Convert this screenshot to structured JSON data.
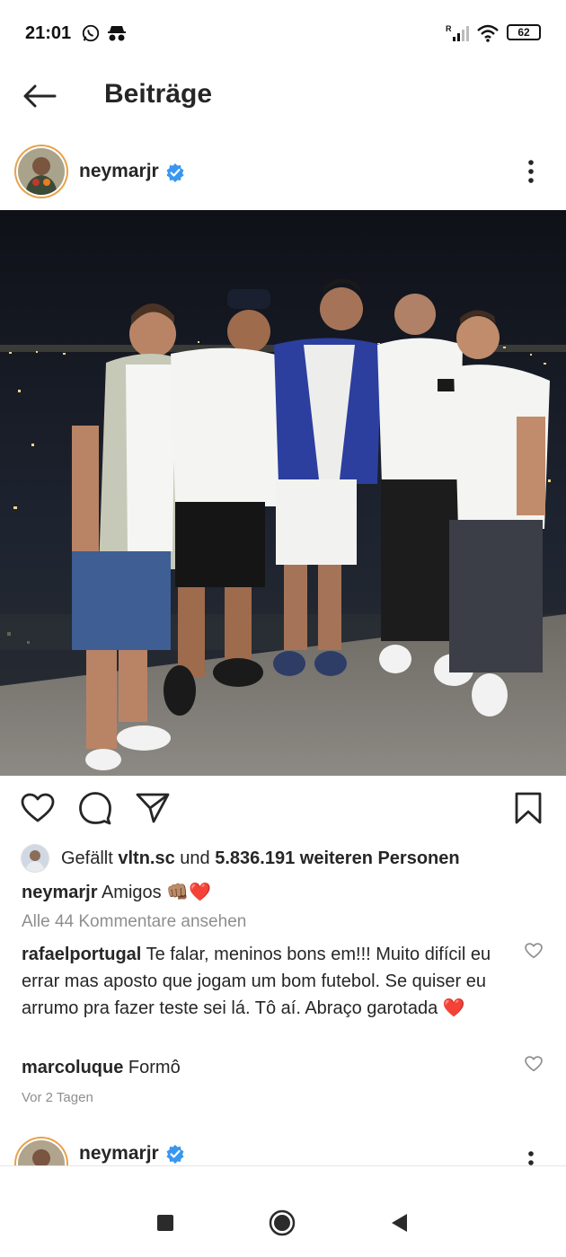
{
  "status_bar": {
    "time": "21:01",
    "battery": "62",
    "icons": [
      "whatsapp-icon",
      "incognito-icon",
      "signal-icon",
      "wifi-icon",
      "battery-icon"
    ]
  },
  "header": {
    "title": "Beiträge",
    "back_icon": "arrow-left-icon"
  },
  "post": {
    "username": "neymarjr",
    "verified": true,
    "image_alt": "Five men in white outfits posing on a rooftop at night",
    "actions": [
      "like-heart-icon",
      "comment-bubble-icon",
      "share-send-icon",
      "bookmark-icon"
    ],
    "likes": {
      "prefix": "Gefällt",
      "user": "vltn.sc",
      "connector": "und",
      "count_text": "5.836.191 weiteren Personen"
    },
    "caption": {
      "username": "neymarjr",
      "text": "Amigos",
      "emojis": "👊🏽❤️"
    },
    "view_all_comments": "Alle 44 Kommentare ansehen",
    "comments": [
      {
        "username": "rafaelportugal",
        "text": "Te falar, meninos bons em!!! Muito difícil eu errar mas aposto que jogam um bom futebol. Se quiser eu arrumo pra fazer teste sei lá. Tô aí. Abraço garotada",
        "emoji": "❤️"
      },
      {
        "username": "marcoluque",
        "text": "Formô"
      }
    ],
    "date": "Vor 2 Tagen"
  },
  "next_post": {
    "username": "neymarjr",
    "verified": true
  },
  "nav_bar": {
    "buttons": [
      "recents-square-icon",
      "home-circle-icon",
      "back-triangle-icon"
    ]
  },
  "colors": {
    "verified_blue": "#3897f0",
    "text": "#262626",
    "muted": "#8e8e8e",
    "heart_red": "#e0245e"
  }
}
